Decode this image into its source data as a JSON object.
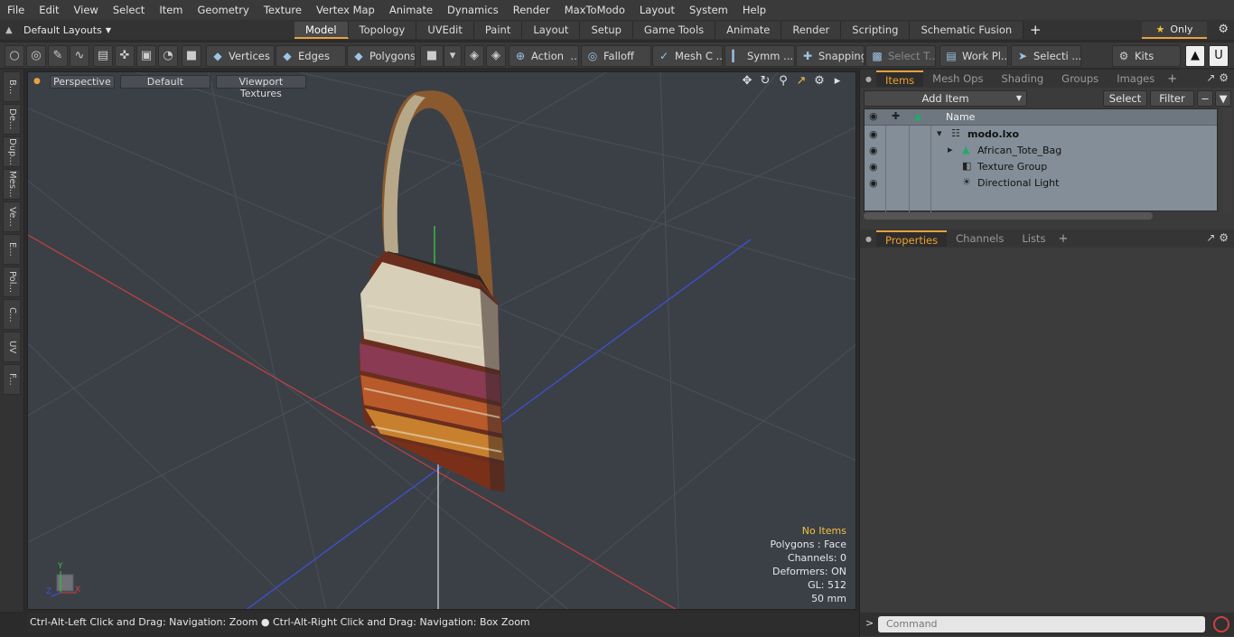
{
  "menu": [
    "File",
    "Edit",
    "View",
    "Select",
    "Item",
    "Geometry",
    "Texture",
    "Vertex Map",
    "Animate",
    "Dynamics",
    "Render",
    "MaxToModo",
    "Layout",
    "System",
    "Help"
  ],
  "layouts_label": "Default Layouts",
  "tabs": [
    {
      "label": "Model",
      "active": true
    },
    {
      "label": "Topology",
      "active": false
    },
    {
      "label": "UVEdit",
      "active": false
    },
    {
      "label": "Paint",
      "active": false
    },
    {
      "label": "Layout",
      "active": false
    },
    {
      "label": "Setup",
      "active": false
    },
    {
      "label": "Game Tools",
      "active": false
    },
    {
      "label": "Animate",
      "active": false
    },
    {
      "label": "Render",
      "active": false
    },
    {
      "label": "Scripting",
      "active": false
    },
    {
      "label": "Schematic Fusion",
      "active": false
    }
  ],
  "tab_plus": "+",
  "only_label": "Only",
  "toolbar": {
    "vertices": "Vertices",
    "edges": "Edges",
    "polygons": "Polygons",
    "action": "Action",
    "falloff": "Falloff",
    "mesh": "Mesh C ...",
    "symm": "Symm ...",
    "snapping": "Snapping",
    "select_t": "Select T...",
    "work_pl": "Work Pl...",
    "selecti": "Selecti ...",
    "kits": "Kits"
  },
  "left_tabs": [
    "B...",
    "De...",
    "Dup...",
    "Mes...",
    "Ve...",
    "E...",
    "Pol...",
    "C...",
    "UV",
    "F..."
  ],
  "viewport": {
    "perspective": "Perspective",
    "default": "Default",
    "textures": "Viewport Textures",
    "stats": {
      "no_items": "No Items",
      "polygons": "Polygons : Face",
      "channels": "Channels: 0",
      "deformers": "Deformers: ON",
      "gl": "GL: 512",
      "mm": "50 mm"
    },
    "axis_x": "X",
    "axis_y": "Y",
    "axis_z": "Z"
  },
  "status_text": "Ctrl-Alt-Left Click and Drag: Navigation: Zoom ● Ctrl-Alt-Right Click and Drag: Navigation: Box Zoom",
  "items_panel": {
    "tabs": [
      {
        "label": "Items",
        "active": true
      },
      {
        "label": "Mesh Ops",
        "active": false
      },
      {
        "label": "Shading",
        "active": false
      },
      {
        "label": "Groups",
        "active": false
      },
      {
        "label": "Images",
        "active": false
      }
    ],
    "add_item": "Add Item",
    "select": "Select",
    "filter": "Filter",
    "name_header": "Name",
    "rows": [
      {
        "label": "modo.lxo"
      },
      {
        "label": "African_Tote_Bag"
      },
      {
        "label": "Texture Group"
      },
      {
        "label": "Directional Light"
      }
    ]
  },
  "props_panel": {
    "tabs": [
      {
        "label": "Properties",
        "active": true
      },
      {
        "label": "Channels",
        "active": false
      },
      {
        "label": "Lists",
        "active": false
      }
    ]
  },
  "command_placeholder": "Command",
  "colors": {
    "accent": "#e8a23c",
    "x_axis": "#d04040",
    "y_axis": "#40c040",
    "z_axis": "#4050e0"
  }
}
